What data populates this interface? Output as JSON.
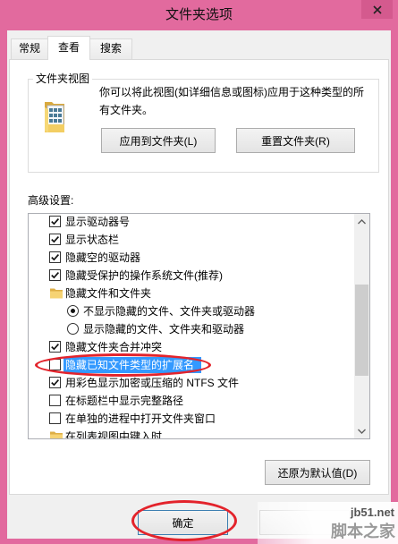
{
  "window": {
    "title": "文件夹选项",
    "frame_color": "#E26A9E",
    "close_icon": "close-icon"
  },
  "tabs": [
    {
      "label": "常规",
      "selected": false
    },
    {
      "label": "查看",
      "selected": true
    },
    {
      "label": "搜索",
      "selected": false
    }
  ],
  "folder_views": {
    "group_label": "文件夹视图",
    "icon": "folder-view-icon",
    "description": "你可以将此视图(如详细信息或图标)应用于这种类型的所有文件夹。",
    "apply_button": "应用到文件夹(L)",
    "reset_button": "重置文件夹(R)"
  },
  "advanced": {
    "label": "高级设置:",
    "items": [
      {
        "type": "checkbox",
        "label": "显示驱动器号",
        "checked": true,
        "level": 0
      },
      {
        "type": "checkbox",
        "label": "显示状态栏",
        "checked": true,
        "level": 0
      },
      {
        "type": "checkbox",
        "label": "隐藏空的驱动器",
        "checked": true,
        "level": 0
      },
      {
        "type": "checkbox",
        "label": "隐藏受保护的操作系统文件(推荐)",
        "checked": true,
        "level": 0
      },
      {
        "type": "group",
        "label": "隐藏文件和文件夹",
        "icon": "folder-icon",
        "level": 0
      },
      {
        "type": "radio",
        "label": "不显示隐藏的文件、文件夹或驱动器",
        "checked": true,
        "level": 1
      },
      {
        "type": "radio",
        "label": "显示隐藏的文件、文件夹和驱动器",
        "checked": false,
        "level": 1
      },
      {
        "type": "checkbox",
        "label": "隐藏文件夹合并冲突",
        "checked": true,
        "level": 0
      },
      {
        "type": "checkbox",
        "label": "隐藏已知文件类型的扩展名",
        "checked": false,
        "level": 0,
        "selected": true
      },
      {
        "type": "checkbox",
        "label": "用彩色显示加密或压缩的 NTFS 文件",
        "checked": true,
        "level": 0
      },
      {
        "type": "checkbox",
        "label": "在标题栏中显示完整路径",
        "checked": false,
        "level": 0
      },
      {
        "type": "checkbox",
        "label": "在单独的进程中打开文件夹窗口",
        "checked": false,
        "level": 0
      },
      {
        "type": "group",
        "label": "在列表视图中键入时",
        "icon": "folder-icon",
        "level": 0
      }
    ],
    "scrollbar": {
      "scroll_position": 0.54,
      "visible_fraction": 0.47
    },
    "selection_color": "#3399FF",
    "restore_button": "还原为默认值(D)"
  },
  "footer": {
    "ok_button": "确定"
  },
  "annotations": {
    "color": "#E3232B"
  },
  "watermark": {
    "site": "jb51.net",
    "brand": "脚本之家"
  }
}
